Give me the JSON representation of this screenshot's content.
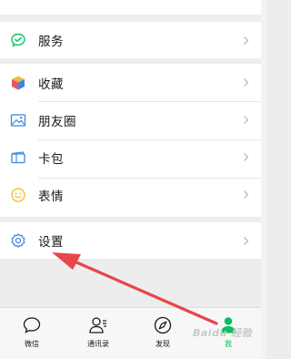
{
  "menu": {
    "service": {
      "label": "服务",
      "icon": "service-icon"
    },
    "items": [
      {
        "label": "收藏",
        "icon": "favorites-icon"
      },
      {
        "label": "朋友圈",
        "icon": "moments-icon"
      },
      {
        "label": "卡包",
        "icon": "card-wallet-icon"
      },
      {
        "label": "表情",
        "icon": "sticker-icon"
      }
    ],
    "settings": {
      "label": "设置",
      "icon": "gear-icon"
    }
  },
  "tabbar": {
    "tabs": [
      {
        "label": "微信",
        "icon": "chat-bubble-icon",
        "active": false
      },
      {
        "label": "通讯录",
        "icon": "contacts-icon",
        "active": false
      },
      {
        "label": "发现",
        "icon": "compass-icon",
        "active": false
      },
      {
        "label": "我",
        "icon": "me-person-icon",
        "active": true
      }
    ]
  },
  "watermark": {
    "text": "Baidu 经验"
  },
  "colors": {
    "accent_green": "#07c160",
    "annotation_arrow": "#e8454b",
    "background": "#ededed",
    "card": "#ffffff"
  }
}
